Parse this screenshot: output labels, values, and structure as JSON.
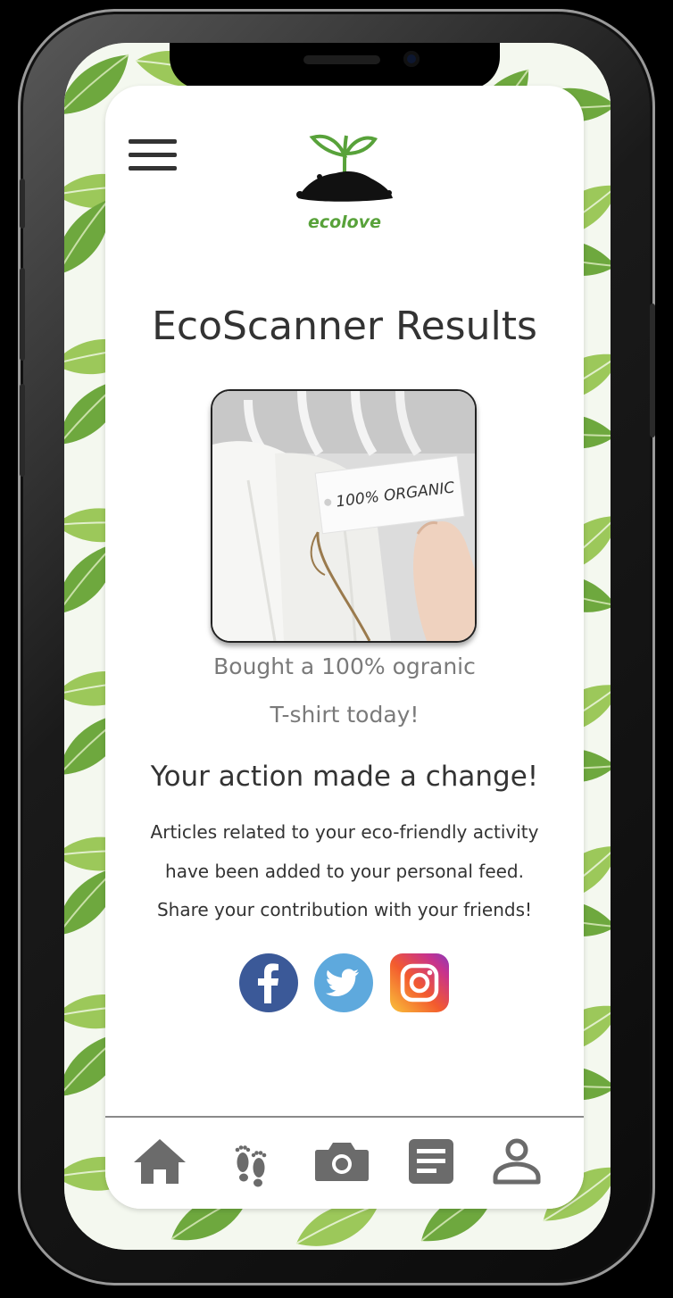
{
  "app": {
    "brand": "ecolove",
    "title": "EcoScanner Results"
  },
  "result": {
    "image_label": "100% ORGANIC",
    "caption_line1": "Bought a 100% ogranic",
    "caption_line2": "T-shirt today!"
  },
  "impact": {
    "heading": "Your action made a change!",
    "line1": "Articles related to your eco-friendly activity",
    "line2": "have been added to your personal feed.",
    "line3": "Share your contribution with your friends!"
  },
  "share": {
    "facebook": "facebook-icon",
    "twitter": "twitter-icon",
    "instagram": "instagram-icon"
  },
  "tabs": [
    {
      "icon": "home-icon"
    },
    {
      "icon": "footprints-icon"
    },
    {
      "icon": "camera-icon"
    },
    {
      "icon": "articles-icon"
    },
    {
      "icon": "profile-icon"
    }
  ],
  "colors": {
    "brand_green": "#58a23a",
    "tab_icon": "#6b6b6b",
    "facebook": "#3b5998",
    "twitter": "#5ea9dd"
  }
}
